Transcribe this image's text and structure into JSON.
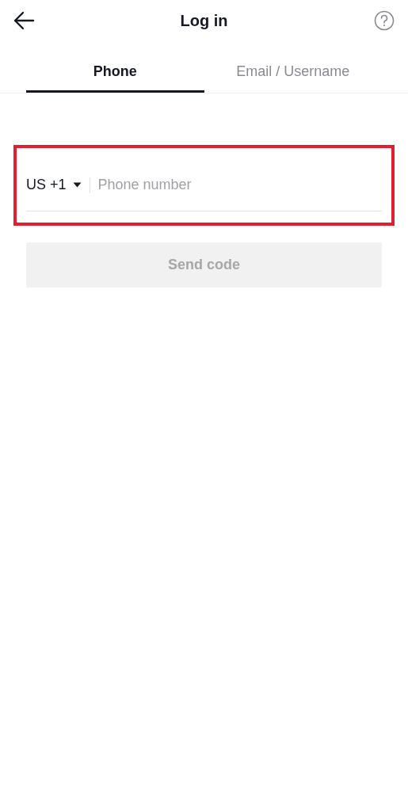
{
  "header": {
    "title": "Log in"
  },
  "tabs": [
    {
      "label": "Phone",
      "selected": true
    },
    {
      "label": "Email / Username",
      "selected": false
    }
  ],
  "phone_form": {
    "highlighted": true,
    "country_code": "US +1",
    "placeholder": "Phone number"
  },
  "send_button": {
    "label": "Send code",
    "disabled": true
  }
}
